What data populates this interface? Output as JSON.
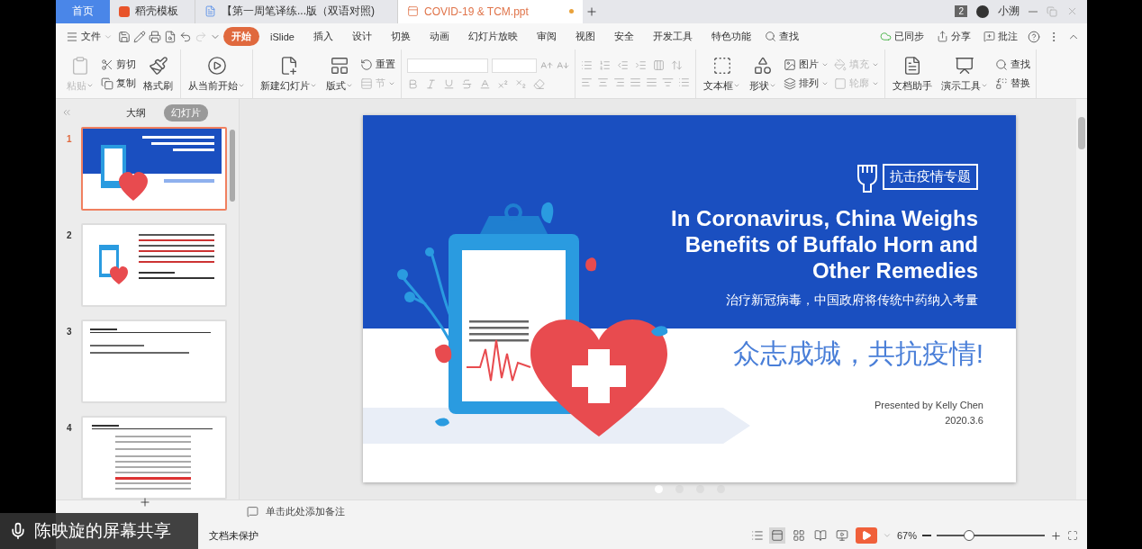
{
  "tabs": [
    {
      "label": "首页",
      "kind": "home",
      "selected": false,
      "modified": false
    },
    {
      "label": "稻壳模板",
      "kind": "template",
      "selected": false,
      "modified": false
    },
    {
      "label": "【第一周笔译练...版（双语对照)",
      "kind": "doc",
      "selected": false,
      "modified": false
    },
    {
      "label": "COVID-19 & TCM.ppt",
      "kind": "ppt",
      "selected": true,
      "modified": true
    }
  ],
  "account": {
    "badge": "2",
    "user": "小溯"
  },
  "menu": {
    "file": "文件",
    "tabs": [
      {
        "label": "开始",
        "selected": true
      },
      {
        "label": "iSlide",
        "selected": false
      },
      {
        "label": "插入",
        "selected": false
      },
      {
        "label": "设计",
        "selected": false
      },
      {
        "label": "切换",
        "selected": false
      },
      {
        "label": "动画",
        "selected": false
      },
      {
        "label": "幻灯片放映",
        "selected": false
      },
      {
        "label": "审阅",
        "selected": false
      },
      {
        "label": "视图",
        "selected": false
      },
      {
        "label": "安全",
        "selected": false
      },
      {
        "label": "开发工具",
        "selected": false
      },
      {
        "label": "特色功能",
        "selected": false
      }
    ],
    "search": "查找",
    "actions": [
      "已同步",
      "分享",
      "批注"
    ]
  },
  "ribbon": [
    {
      "columns": [
        [
          {
            "label": "粘贴",
            "kind": "large",
            "disabled": true,
            "caret": true
          }
        ],
        [
          {
            "label": "剪切",
            "kind": "small",
            "disabled": false,
            "caret": false
          },
          {
            "label": "复制",
            "kind": "small",
            "disabled": false,
            "caret": false
          }
        ],
        [
          {
            "label": "格式刷",
            "kind": "large",
            "disabled": false,
            "caret": false
          }
        ]
      ]
    },
    {
      "columns": [
        [
          {
            "label": "从当前开始",
            "kind": "large",
            "disabled": false,
            "caret": true
          }
        ]
      ]
    },
    {
      "columns": [
        [
          {
            "label": "新建幻灯片",
            "kind": "large",
            "disabled": false,
            "caret": true
          }
        ],
        [
          {
            "label": "版式",
            "kind": "large",
            "disabled": false,
            "caret": true
          }
        ],
        [
          {
            "label": "重置",
            "kind": "small",
            "disabled": false,
            "caret": false
          },
          {
            "label": "节",
            "kind": "small",
            "disabled": true,
            "caret": true
          }
        ]
      ]
    },
    {
      "kind": "font"
    },
    {
      "kind": "paragraph"
    },
    {
      "columns": [
        [
          {
            "label": "文本框",
            "kind": "large",
            "disabled": false,
            "caret": true
          }
        ],
        [
          {
            "label": "形状",
            "kind": "large",
            "disabled": false,
            "caret": true
          }
        ],
        [
          {
            "label": "图片",
            "kind": "small",
            "disabled": false,
            "caret": true
          },
          {
            "label": "排列",
            "kind": "small",
            "disabled": false,
            "caret": true
          }
        ],
        [
          {
            "label": "填充",
            "kind": "small",
            "disabled": true,
            "caret": true
          },
          {
            "label": "轮廓",
            "kind": "small",
            "disabled": true,
            "caret": true
          }
        ]
      ]
    },
    {
      "columns": [
        [
          {
            "label": "文档助手",
            "kind": "large",
            "disabled": false,
            "caret": false
          }
        ],
        [
          {
            "label": "演示工具",
            "kind": "large",
            "disabled": false,
            "caret": true
          }
        ],
        [
          {
            "label": "查找",
            "kind": "small",
            "disabled": false,
            "caret": false
          },
          {
            "label": "替换",
            "kind": "small",
            "disabled": false,
            "caret": false
          }
        ]
      ]
    }
  ],
  "panel": {
    "views": [
      {
        "label": "大纲",
        "selected": false
      },
      {
        "label": "幻灯片",
        "selected": true
      }
    ],
    "slides": [
      {
        "number": "1",
        "kind": "title",
        "selected": true
      },
      {
        "number": "2",
        "kind": "text",
        "selected": false
      },
      {
        "number": "3",
        "kind": "terms",
        "selected": false
      },
      {
        "number": "4",
        "kind": "article",
        "selected": false
      }
    ]
  },
  "slide": {
    "badge": "抗击疫情专题",
    "title": [
      "In Coronavirus, China Weighs",
      "Benefits of Buffalo Horn and",
      "Other Remedies"
    ],
    "subtitle": "治疗新冠病毒，中国政府将传统中药纳入考量",
    "slogan": "众志成城，共抗疫情!",
    "presenter": "Presented by Kelly Chen",
    "date": "2020.3.6"
  },
  "pager": [
    {
      "selected": true
    },
    {
      "selected": false
    },
    {
      "selected": false
    },
    {
      "selected": false
    }
  ],
  "notes": {
    "placeholder": "单击此处添加备注"
  },
  "status": {
    "protection": "文档未保护",
    "views": [
      {
        "selected": true
      },
      {
        "selected": false
      },
      {
        "selected": false
      },
      {
        "selected": false
      }
    ],
    "zoom": "67%",
    "level": 0.3
  },
  "share_overlay": {
    "text": "陈映旋的屏幕共享"
  }
}
